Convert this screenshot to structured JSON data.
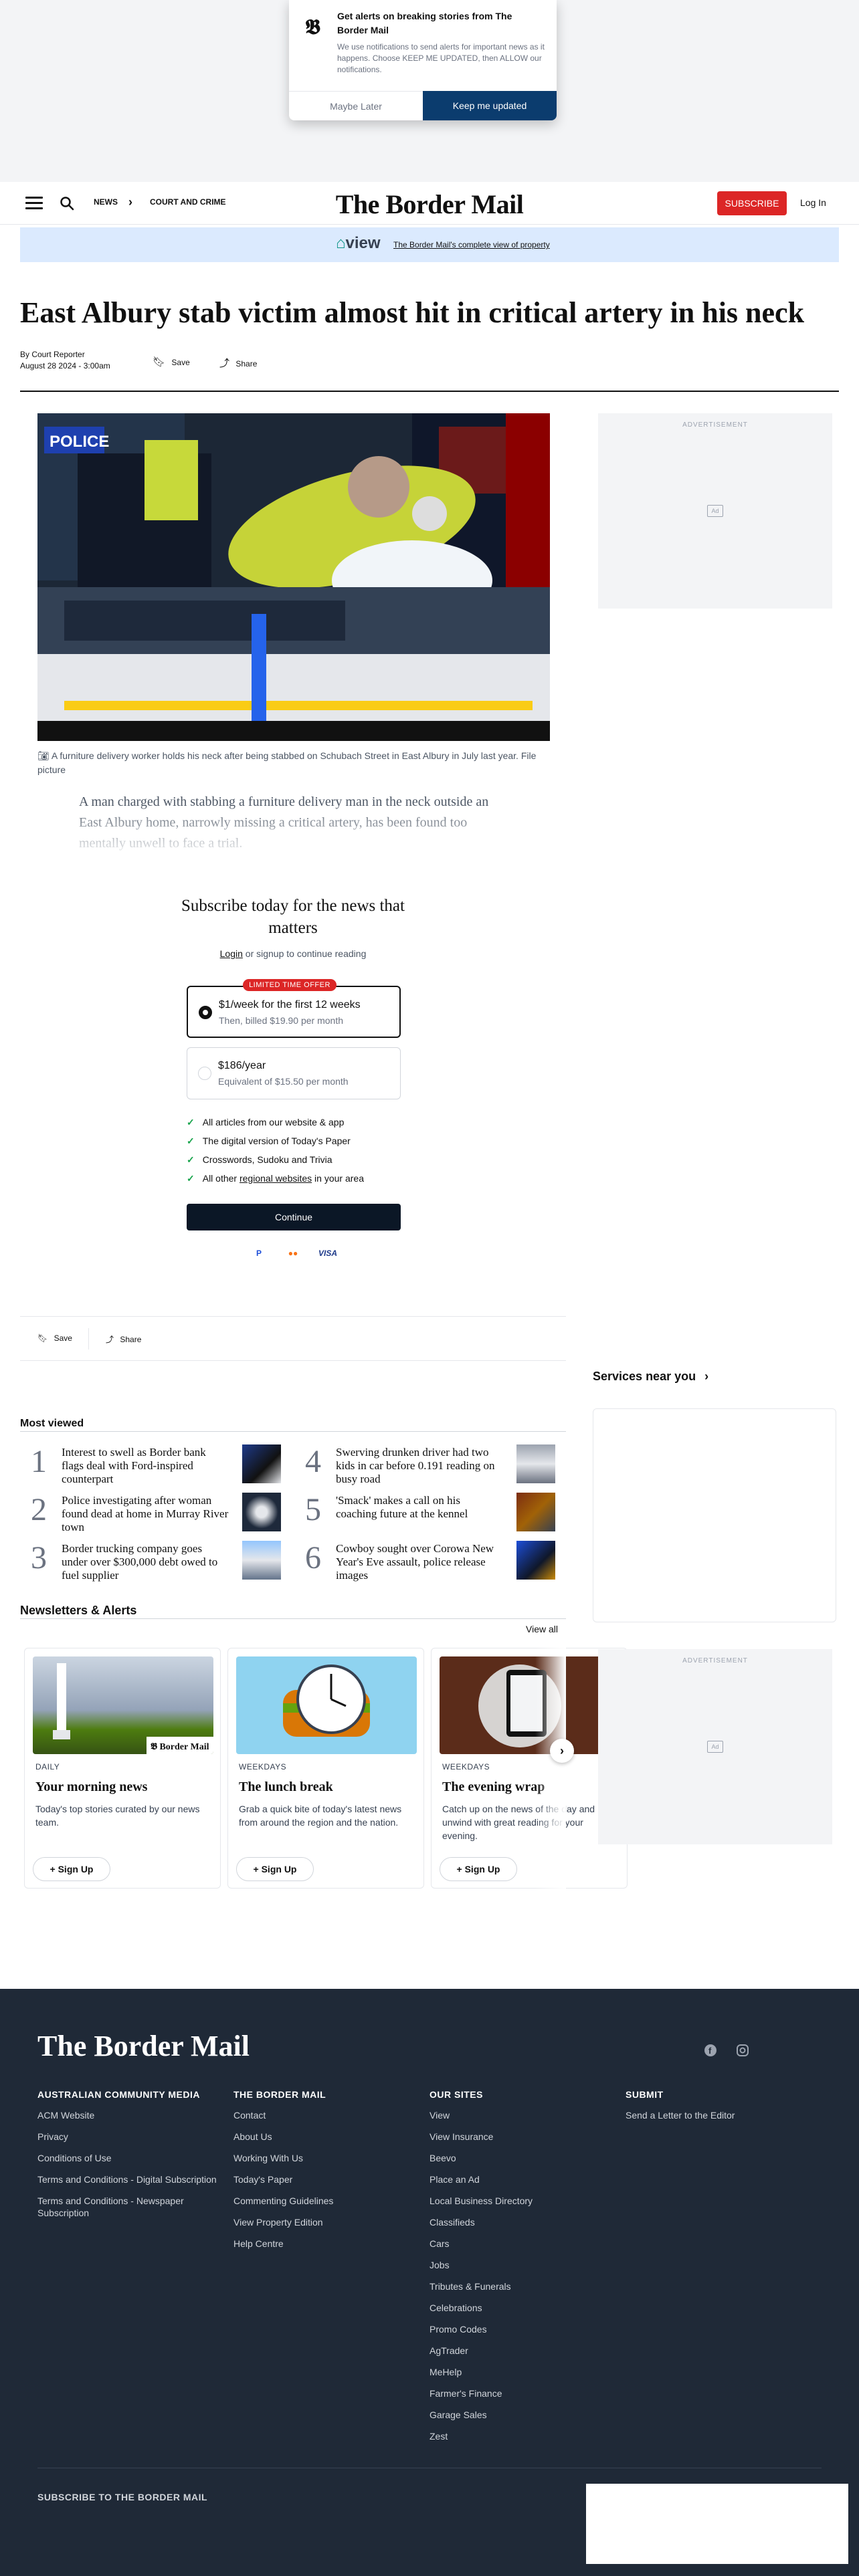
{
  "notification": {
    "title": "Get alerts on breaking stories from The Border Mail",
    "body": "We use notifications to send alerts for important news as it happens. Choose KEEP ME UPDATED, then ALLOW our notifications.",
    "later_label": "Maybe Later",
    "keep_label": "Keep me updated"
  },
  "header": {
    "breadcrumb": [
      "NEWS",
      "COURT AND CRIME"
    ],
    "masthead": "The Border Mail",
    "subscribe_label": "SUBSCRIBE",
    "login_label": "Log In"
  },
  "view_banner": {
    "logo": "view",
    "text": "The Border Mail's complete view of property"
  },
  "article": {
    "headline": "East Albury stab victim almost hit in critical artery in his neck",
    "byline": "By Court Reporter",
    "date": "August 28 2024 - 3:00am",
    "save_label": "Save",
    "share_label": "Share",
    "caption": "A furniture delivery worker holds his neck after being stabbed on Schubach Street in East Albury in July last year. File picture",
    "body": "A man charged with stabbing a furniture delivery man in the neck outside an East Albury home, narrowly missing a critical artery, has been found too mentally unwell to face a trial."
  },
  "ads": {
    "label": "ADVERTISEMENT",
    "badge": "Ad"
  },
  "subscribe": {
    "title": "Subscribe today for the news that matters",
    "login_text": "or signup to continue reading",
    "login_link": "Login",
    "offer_badge": "LIMITED TIME OFFER",
    "plans": [
      {
        "name": "$1/week for the first 12 weeks",
        "detail": "Then, billed $19.90 per month",
        "selected": true
      },
      {
        "name": "$186/year",
        "detail": "Equivalent of $15.50 per month",
        "selected": false
      }
    ],
    "features": [
      "All articles from our website & app",
      "The digital version of Today's Paper",
      "Crosswords, Sudoku and Trivia"
    ],
    "feature_last_prefix": "All other",
    "feature_last_link": "regional websites",
    "feature_last_suffix": "in your area",
    "continue_label": "Continue",
    "payments": [
      "P",
      "●●",
      "VISA"
    ]
  },
  "services": {
    "title": "Services near you"
  },
  "most_viewed": {
    "title": "Most viewed",
    "items": [
      {
        "num": "1",
        "text": "Interest to swell as Border bank flags deal with Ford-inspired counterpart"
      },
      {
        "num": "2",
        "text": "Police investigating after woman found dead at home in Murray River town"
      },
      {
        "num": "3",
        "text": "Border trucking company goes under over $300,000 debt owed to fuel supplier"
      },
      {
        "num": "4",
        "text": "Swerving drunken driver had two kids in car before 0.191 reading on busy road"
      },
      {
        "num": "5",
        "text": "'Smack' makes a call on his coaching future at the kennel"
      },
      {
        "num": "6",
        "text": "Cowboy sought over Corowa New Year's Eve assault, police release images"
      }
    ]
  },
  "newsletters": {
    "title": "Newsletters & Alerts",
    "view_all": "View all",
    "signup_label": "Sign Up",
    "cards": [
      {
        "freq": "DAILY",
        "name": "Your morning news",
        "desc": "Today's top stories curated by our news team."
      },
      {
        "freq": "WEEKDAYS",
        "name": "The lunch break",
        "desc": "Grab a quick bite of today's latest news from around the region and the nation."
      },
      {
        "freq": "WEEKDAYS",
        "name": "The evening wrap",
        "desc": "Catch up on the news of the day and unwind with great reading for your evening."
      }
    ]
  },
  "footer": {
    "logo": "The Border Mail",
    "columns": [
      {
        "heading": "AUSTRALIAN COMMUNITY MEDIA",
        "links": [
          "ACM Website",
          "Privacy",
          "Conditions of Use",
          "Terms and Conditions - Digital Subscription",
          "Terms and Conditions - Newspaper Subscription"
        ]
      },
      {
        "heading": "THE BORDER MAIL",
        "links": [
          "Contact",
          "About Us",
          "Working With Us",
          "Today's Paper",
          "Commenting Guidelines",
          "View Property Edition",
          "Help Centre"
        ]
      },
      {
        "heading": "OUR SITES",
        "links": [
          "View",
          "View Insurance",
          "Beevo",
          "Place an Ad",
          "Local Business Directory",
          "Classifieds",
          "Cars",
          "Jobs",
          "Tributes & Funerals",
          "Celebrations",
          "Promo Codes",
          "AgTrader",
          "MeHelp",
          "Farmer's Finance",
          "Garage Sales",
          "Zest"
        ]
      },
      {
        "heading": "SUBMIT",
        "links": [
          "Send a Letter to the Editor"
        ]
      }
    ],
    "subscribe_label": "SUBSCRIBE TO THE BORDER MAIL"
  }
}
